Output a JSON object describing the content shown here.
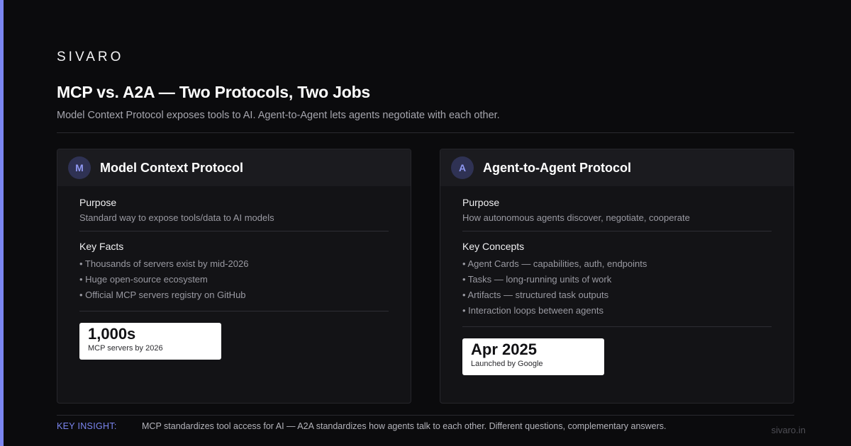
{
  "brand": "SIVARO",
  "title": "MCP vs. A2A — Two Protocols, Two Jobs",
  "subtitle": "Model Context Protocol exposes tools to AI. Agent-to-Agent lets agents negotiate with each other.",
  "colors": {
    "accent": "#7b86f0",
    "background": "#0b0b0d",
    "card": "#131316"
  },
  "left_card": {
    "badge": "M",
    "title": "Model Context Protocol",
    "purpose_label": "Purpose",
    "purpose_text": "Standard way to expose tools/data to AI models",
    "list_label": "Key Facts",
    "items": [
      "• Thousands of servers exist by mid-2026",
      "• Huge open-source ecosystem",
      "• Official MCP servers registry on GitHub"
    ],
    "stat_value": "1,000s",
    "stat_caption": "MCP servers by 2026"
  },
  "right_card": {
    "badge": "A",
    "title": "Agent-to-Agent Protocol",
    "purpose_label": "Purpose",
    "purpose_text": "How autonomous agents discover, negotiate, cooperate",
    "list_label": "Key Concepts",
    "items": [
      "• Agent Cards — capabilities, auth, endpoints",
      "• Tasks — long-running units of work",
      "• Artifacts — structured task outputs",
      "• Interaction loops between agents"
    ],
    "stat_value": "Apr 2025",
    "stat_caption": "Launched by Google"
  },
  "insight": {
    "label": "KEY INSIGHT:",
    "text": "MCP standardizes tool access for AI — A2A standardizes how agents talk to each other. Different questions, complementary answers."
  },
  "footer_url": "sivaro.in"
}
